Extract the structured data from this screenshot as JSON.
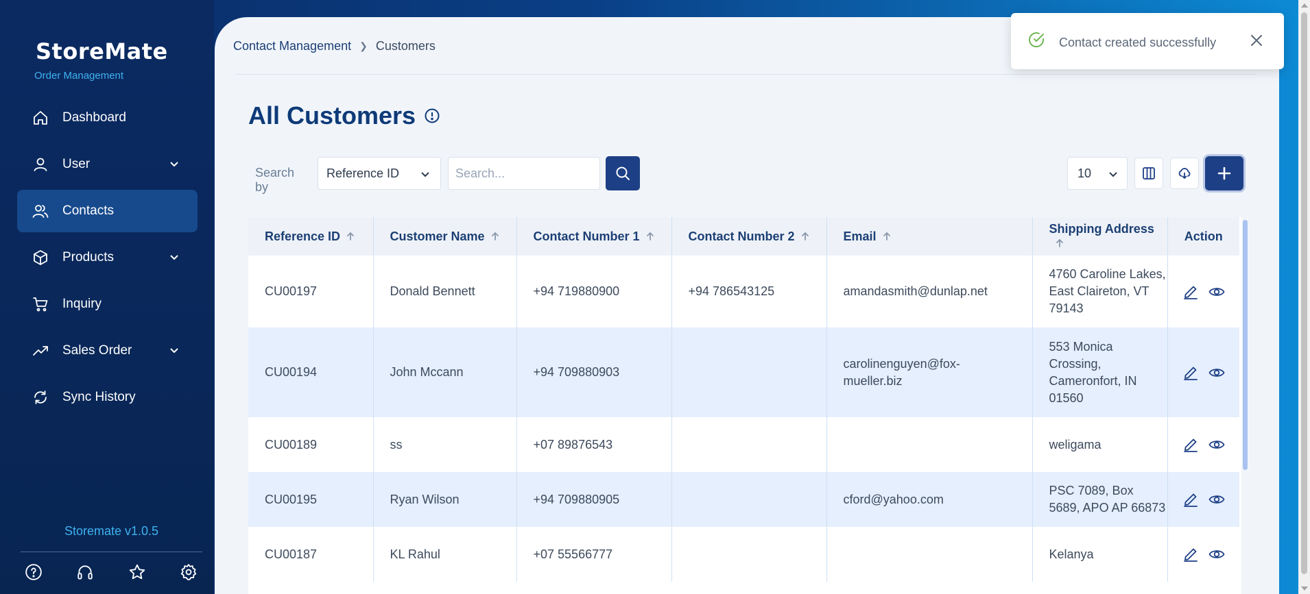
{
  "app": {
    "logo_text": "StoreMate",
    "logo_subtitle": "Order Management",
    "version": "Storemate v1.0.5"
  },
  "sidebar": {
    "items": [
      {
        "label": "Dashboard",
        "icon": "home-icon",
        "expandable": false,
        "active": false
      },
      {
        "label": "User",
        "icon": "user-icon",
        "expandable": true,
        "active": false
      },
      {
        "label": "Contacts",
        "icon": "users-icon",
        "expandable": false,
        "active": true
      },
      {
        "label": "Products",
        "icon": "box-icon",
        "expandable": true,
        "active": false
      },
      {
        "label": "Inquiry",
        "icon": "cart-icon",
        "expandable": false,
        "active": false
      },
      {
        "label": "Sales Order",
        "icon": "trend-icon",
        "expandable": true,
        "active": false
      },
      {
        "label": "Sync History",
        "icon": "sync-icon",
        "expandable": false,
        "active": false
      }
    ],
    "bottom_icons": [
      "help-icon",
      "headset-icon",
      "star-icon",
      "settings-icon"
    ]
  },
  "breadcrumb": {
    "parent": "Contact Management",
    "current": "Customers"
  },
  "page": {
    "title": "All Customers"
  },
  "toolbar": {
    "search_by_label": "Search by",
    "search_by_value": "Reference ID",
    "search_placeholder": "Search...",
    "page_size": "10"
  },
  "table": {
    "columns": [
      "Reference ID",
      "Customer Name",
      "Contact Number 1",
      "Contact Number 2",
      "Email",
      "Shipping Address",
      "Action"
    ],
    "rows": [
      {
        "ref": "CU00197",
        "name": "Donald Bennett",
        "phone1": "+94 719880900",
        "phone2": "+94 786543125",
        "email": "amandasmith@dunlap.net",
        "address": "4760 Caroline Lakes, East Claireton, VT 79143"
      },
      {
        "ref": "CU00194",
        "name": "John Mccann",
        "phone1": "+94 709880903",
        "phone2": "",
        "email": "carolinenguyen@fox-mueller.biz",
        "address": "553 Monica Crossing, Cameronfort, IN 01560"
      },
      {
        "ref": "CU00189",
        "name": "ss",
        "phone1": "+07 89876543",
        "phone2": "",
        "email": "",
        "address": "weligama"
      },
      {
        "ref": "CU00195",
        "name": "Ryan Wilson",
        "phone1": "+94 709880905",
        "phone2": "",
        "email": "cford@yahoo.com",
        "address": "PSC 7089, Box 5689, APO AP 66873"
      },
      {
        "ref": "CU00187",
        "name": "KL Rahul",
        "phone1": "+07 55566777",
        "phone2": "",
        "email": "",
        "address": "Kelanya"
      }
    ]
  },
  "toast": {
    "message": "Contact created successfully",
    "status_color": "#62b043"
  },
  "colors": {
    "primary": "#1d3f85",
    "sidebar_bg": "#0b2a62",
    "accent": "#3fb2f0"
  }
}
